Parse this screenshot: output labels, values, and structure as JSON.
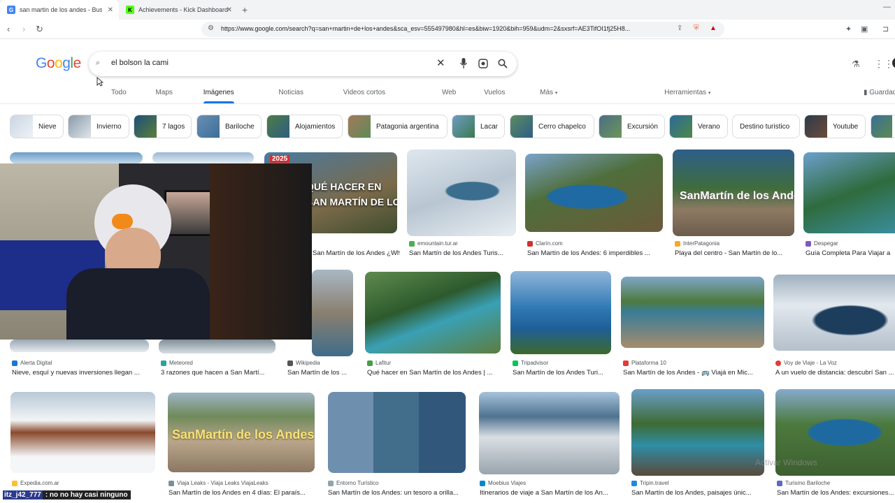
{
  "tabs": [
    {
      "title": "san martin de los andes - Buscar",
      "favicon_color": "#4285f4",
      "favicon_letter": "G"
    },
    {
      "title": "Achievements - Kick Dashboard",
      "favicon_color": "#53fc18",
      "favicon_letter": "K"
    }
  ],
  "address": {
    "url": "https://www.google.com/search?q=san+martin+de+los+andes&sca_esv=555497980&hl=es&biw=1920&bih=959&udm=2&sxsrf=AE3TifOI1fj25H8..."
  },
  "search": {
    "query": "el bolson la cami",
    "logo": "Google"
  },
  "nav_tabs": [
    "Todo",
    "Maps",
    "Imágenes",
    "Noticias",
    "Videos cortos",
    "Web",
    "Vuelos",
    "Más",
    "Herramientas",
    "Guardados"
  ],
  "chips": [
    "Nieve",
    "Invierno",
    "7 lagos",
    "Bariloche",
    "Alojamientos",
    "Patagonia argentina",
    "Lacar",
    "Cerro chapelco",
    "Excursión",
    "Verano",
    "Destino turistico",
    "Youtube"
  ],
  "row1": [
    {
      "source": "",
      "caption": "San Martín de los Andes ¿What ..."
    },
    {
      "source": "emountain.tur.ar",
      "caption": "San Martín de los Andes Turis..."
    },
    {
      "source": "Clarín.com",
      "caption": "San Martín de los Andes: 6 imperdibles ..."
    },
    {
      "source": "InterPatagonia",
      "caption": "Playa del centro - San Martín de lo..."
    },
    {
      "source": "Despegar",
      "caption": "Guía Completa Para Viajar a"
    }
  ],
  "row2": [
    {
      "source": "Alerta Digital",
      "caption": "Nieve, esquí y nuevas inversiones llegan ..."
    },
    {
      "source": "Meteored",
      "caption": "3 razones que hacen a San Martí..."
    },
    {
      "source": "Wikipedia",
      "caption": "San Martín de los ..."
    },
    {
      "source": "Lafitur",
      "caption": "Qué hacer en San Martín de los Andes | ..."
    },
    {
      "source": "Tripadvisor",
      "caption": "San Martín de los Andes Turi..."
    },
    {
      "source": "Plataforma 10",
      "caption": "San Martín de los Andes - 🚌 Viajá en Mic..."
    },
    {
      "source": "Voy de Viaje - La Voz",
      "caption": "A un vuelo de distancia: descubrí San ..."
    }
  ],
  "row3": [
    {
      "source": "Expedia.com.ar",
      "caption": ""
    },
    {
      "source": "Viaja Leaks - Viaja Leaks ViajaLeaks",
      "caption": "San Martín de los Andes en 4 días: El paraís..."
    },
    {
      "source": "Entorno Turístico",
      "caption": "San Martín de los Andes: un tesoro a orilla..."
    },
    {
      "source": "Moebius Viajes",
      "caption": "Itinerarios de viaje a San Martín de los An..."
    },
    {
      "source": "Tripin.travel",
      "caption": "San Martín de los Andes, paisajes únic..."
    },
    {
      "source": "Turismo Bariloche",
      "caption": "San Martín de los Andes: excursiones..."
    }
  ],
  "image_text": {
    "badge": "2025",
    "overlay": "QUÉ HACER EN\nSAN MARTÍN DE LOS ANDES",
    "sign": "SanMartín de los Andes"
  },
  "chat": {
    "user": "itz_j42_777",
    "message": ": no no hay casi ninguno"
  },
  "watermark": "Activar Windows"
}
